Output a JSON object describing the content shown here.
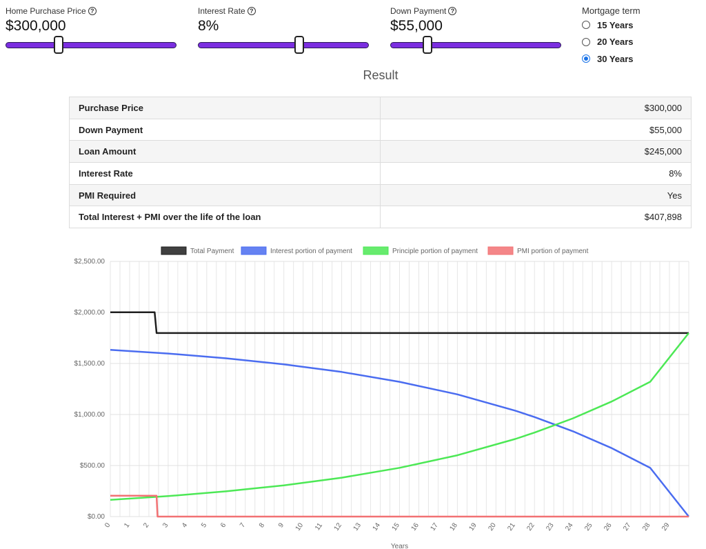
{
  "controls": {
    "home_price": {
      "label": "Home Purchase Price",
      "value": "$300,000",
      "level": 0.3
    },
    "interest_rate": {
      "label": "Interest Rate",
      "value": "8%",
      "level": 0.6
    },
    "down_payment": {
      "label": "Down Payment",
      "value": "$55,000",
      "level": 0.2
    },
    "help_symbol": "?"
  },
  "mortgage_term": {
    "title": "Mortgage term",
    "options": [
      {
        "label": "15 Years",
        "checked": false
      },
      {
        "label": "20 Years",
        "checked": false
      },
      {
        "label": "30 Years",
        "checked": true
      }
    ]
  },
  "result": {
    "heading": "Result",
    "rows": [
      {
        "label": "Purchase Price",
        "value": "$300,000"
      },
      {
        "label": "Down Payment",
        "value": "$55,000"
      },
      {
        "label": "Loan Amount",
        "value": "$245,000"
      },
      {
        "label": "Interest Rate",
        "value": "8%"
      },
      {
        "label": "PMI Required",
        "value": "Yes"
      },
      {
        "label": "Total Interest + PMI over the life of the loan",
        "value": "$407,898"
      }
    ]
  },
  "chart_data": {
    "type": "line",
    "xlabel": "Years",
    "ylabel": "",
    "ylim": [
      0,
      2500
    ],
    "xlim": [
      0,
      30
    ],
    "x_ticks": [
      "0",
      "1",
      "2",
      "3",
      "4",
      "5",
      "6",
      "7",
      "8",
      "9",
      "10",
      "11",
      "12",
      "13",
      "14",
      "15",
      "16",
      "17",
      "18",
      "19",
      "20",
      "21",
      "22",
      "23",
      "24",
      "25",
      "26",
      "27",
      "28",
      "29"
    ],
    "y_ticks": [
      "$0.00",
      "$500.00",
      "$1,000.00",
      "$1,500.00",
      "$2,000.00",
      "$2,500.00"
    ],
    "y_tick_values": [
      0,
      500,
      1000,
      1500,
      2000,
      2500
    ],
    "grid": true,
    "legend_position": "top",
    "series": [
      {
        "name": "Total Payment",
        "color": "#1e1e1e",
        "points": [
          [
            0,
            2002
          ],
          [
            2.3,
            2002
          ],
          [
            2.4,
            1798
          ],
          [
            30,
            1798
          ]
        ]
      },
      {
        "name": "Interest portion of payment",
        "color": "#4a6cf0",
        "points": [
          [
            0,
            1633
          ],
          [
            3,
            1597
          ],
          [
            6,
            1551
          ],
          [
            9,
            1492
          ],
          [
            12,
            1417
          ],
          [
            15,
            1320
          ],
          [
            18,
            1197
          ],
          [
            21,
            1038
          ],
          [
            22,
            975
          ],
          [
            24,
            835
          ],
          [
            26,
            671
          ],
          [
            28,
            477
          ],
          [
            30,
            0
          ]
        ]
      },
      {
        "name": "Principle portion of payment",
        "color": "#4ce855",
        "points": [
          [
            0,
            164
          ],
          [
            3,
            201
          ],
          [
            6,
            247
          ],
          [
            9,
            306
          ],
          [
            12,
            381
          ],
          [
            15,
            478
          ],
          [
            18,
            601
          ],
          [
            21,
            760
          ],
          [
            22,
            823
          ],
          [
            24,
            963
          ],
          [
            26,
            1127
          ],
          [
            28,
            1321
          ],
          [
            30,
            1798
          ]
        ]
      },
      {
        "name": "PMI portion of payment",
        "color": "#f27173",
        "points": [
          [
            0,
            204
          ],
          [
            2.4,
            204
          ],
          [
            2.45,
            0
          ],
          [
            30,
            0
          ]
        ]
      }
    ]
  }
}
